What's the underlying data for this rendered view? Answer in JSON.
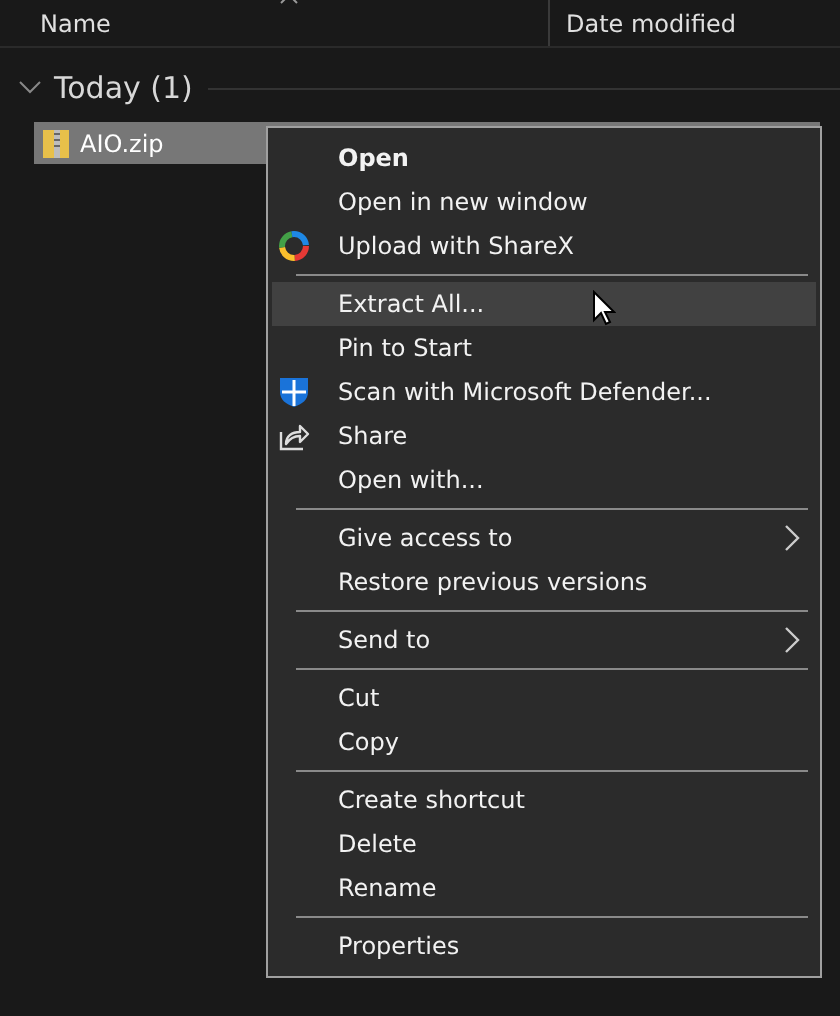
{
  "columns": [
    {
      "label": "Name",
      "sorted": true
    },
    {
      "label": "Date modified",
      "sorted": false
    }
  ],
  "group": {
    "label": "Today (1)",
    "expanded": true
  },
  "files": [
    {
      "name": "AIO.zip",
      "selected": true
    }
  ],
  "context_menu": {
    "items": [
      {
        "kind": "plain",
        "label": "Open",
        "default": true,
        "submenu": false,
        "selected": false
      },
      {
        "kind": "plain",
        "label": "Open in new window",
        "default": false,
        "submenu": false,
        "selected": false
      },
      {
        "kind": "sharex",
        "label": "Upload with ShareX",
        "default": false,
        "submenu": false,
        "selected": false
      },
      {
        "kind": "separator"
      },
      {
        "kind": "plain",
        "label": "Extract All...",
        "default": false,
        "submenu": false,
        "selected": true
      },
      {
        "kind": "plain",
        "label": "Pin to Start",
        "default": false,
        "submenu": false,
        "selected": false
      },
      {
        "kind": "defender",
        "label": "Scan with Microsoft Defender...",
        "default": false,
        "submenu": false,
        "selected": false
      },
      {
        "kind": "share",
        "label": "Share",
        "default": false,
        "submenu": false,
        "selected": false
      },
      {
        "kind": "plain",
        "label": "Open with...",
        "default": false,
        "submenu": false,
        "selected": false
      },
      {
        "kind": "separator"
      },
      {
        "kind": "plain",
        "label": "Give access to",
        "default": false,
        "submenu": true,
        "selected": false
      },
      {
        "kind": "plain",
        "label": "Restore previous versions",
        "default": false,
        "submenu": false,
        "selected": false
      },
      {
        "kind": "separator"
      },
      {
        "kind": "plain",
        "label": "Send to",
        "default": false,
        "submenu": true,
        "selected": false
      },
      {
        "kind": "separator"
      },
      {
        "kind": "plain",
        "label": "Cut",
        "default": false,
        "submenu": false,
        "selected": false
      },
      {
        "kind": "plain",
        "label": "Copy",
        "default": false,
        "submenu": false,
        "selected": false
      },
      {
        "kind": "separator"
      },
      {
        "kind": "plain",
        "label": "Create shortcut",
        "default": false,
        "submenu": false,
        "selected": false
      },
      {
        "kind": "plain",
        "label": "Delete",
        "default": false,
        "submenu": false,
        "selected": false
      },
      {
        "kind": "plain",
        "label": "Rename",
        "default": false,
        "submenu": false,
        "selected": false
      },
      {
        "kind": "separator"
      },
      {
        "kind": "plain",
        "label": "Properties",
        "default": false,
        "submenu": false,
        "selected": false
      }
    ]
  }
}
